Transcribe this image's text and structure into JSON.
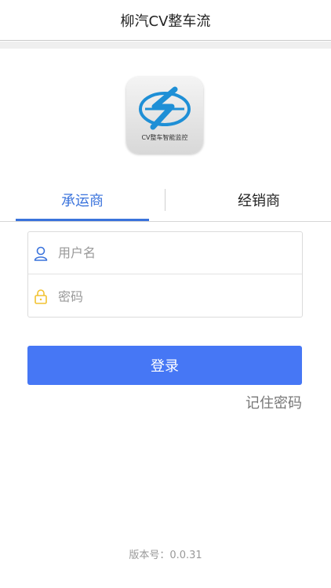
{
  "header": {
    "title": "柳汽CV整车流"
  },
  "logo": {
    "caption": "CV整车智能监控"
  },
  "tabs": [
    {
      "label": "承运商",
      "active": true
    },
    {
      "label": "经销商",
      "active": false
    }
  ],
  "form": {
    "username_placeholder": "用户名",
    "password_placeholder": "密码"
  },
  "login_button": "登录",
  "remember_password": "记住密码",
  "version": {
    "label": "版本号：",
    "number": "0.0.31"
  },
  "colors": {
    "accent": "#4677f5",
    "tab_active": "#3a73dc",
    "lock_icon": "#f2c230"
  },
  "icons": {
    "user": "person-outline-icon",
    "lock": "lock-icon"
  }
}
